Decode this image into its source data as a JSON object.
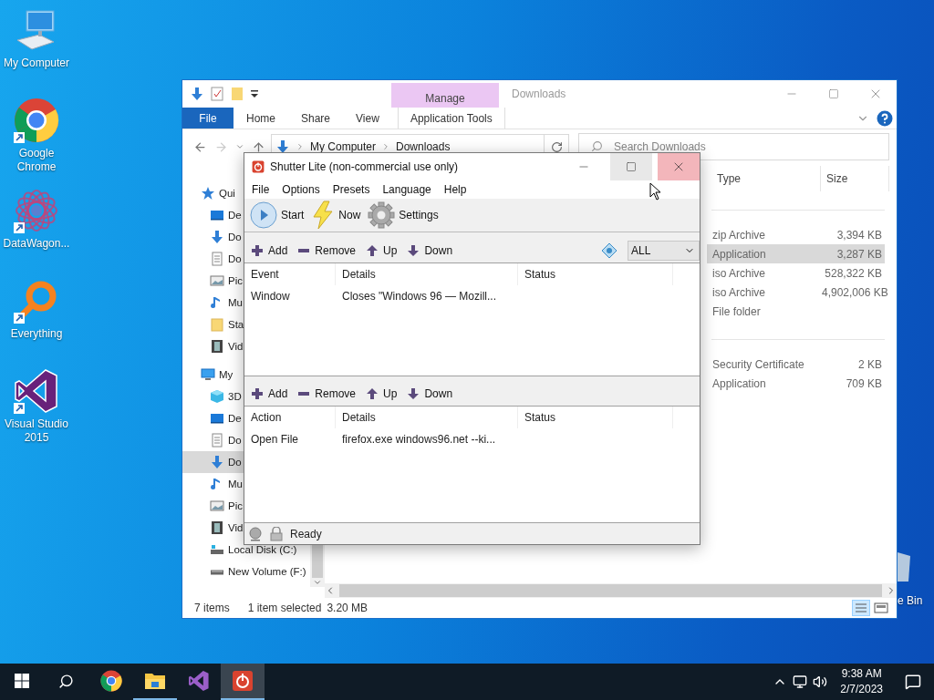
{
  "desktop_icons": [
    {
      "label": "My Computer",
      "kind": "computer",
      "shortcut": false
    },
    {
      "label": "Google Chrome",
      "kind": "chrome",
      "shortcut": true
    },
    {
      "label": "DataWagon...",
      "kind": "datawagon",
      "shortcut": true
    },
    {
      "label": "Everything",
      "kind": "everything",
      "shortcut": true
    },
    {
      "label": "Visual Studio 2015",
      "kind": "vs",
      "shortcut": true
    }
  ],
  "recycle_bin": {
    "label": "e Bin"
  },
  "explorer": {
    "title": "Downloads",
    "context_tab": "Manage",
    "ribbon_tabs": [
      {
        "label": "File",
        "kind": "file"
      },
      {
        "label": "Home",
        "kind": "tab"
      },
      {
        "label": "Share",
        "kind": "tab"
      },
      {
        "label": "View",
        "kind": "tab"
      },
      {
        "label": "Application Tools",
        "kind": "context"
      }
    ],
    "breadcrumb": [
      "My Computer",
      "Downloads"
    ],
    "search": {
      "placeholder": "Search Downloads"
    },
    "nav": [
      {
        "label": "Qui",
        "kind": "star",
        "selected": false,
        "children": [
          {
            "label": "De",
            "kind": "desktop",
            "selected": false
          },
          {
            "label": "Do",
            "kind": "download",
            "selected": false
          },
          {
            "label": "Do",
            "kind": "doc",
            "selected": false
          },
          {
            "label": "Pic",
            "kind": "picture",
            "selected": false
          },
          {
            "label": "Mu",
            "kind": "music",
            "selected": false
          },
          {
            "label": "Sta",
            "kind": "folder",
            "selected": false
          },
          {
            "label": "Vid",
            "kind": "video",
            "selected": false
          }
        ]
      },
      {
        "label": "My",
        "kind": "pc",
        "selected": false,
        "children": [
          {
            "label": "3D",
            "kind": "cube",
            "selected": false
          },
          {
            "label": "De",
            "kind": "desktop",
            "selected": false
          },
          {
            "label": "Do",
            "kind": "doc",
            "selected": false
          },
          {
            "label": "Do",
            "kind": "download",
            "selected": true
          },
          {
            "label": "Mu",
            "kind": "music",
            "selected": false
          },
          {
            "label": "Pic",
            "kind": "picture",
            "selected": false
          },
          {
            "label": "Vid",
            "kind": "video",
            "selected": false
          },
          {
            "label": "Local Disk (C:)",
            "kind": "system-drive",
            "selected": false
          },
          {
            "label": "New Volume (F:)",
            "kind": "drive",
            "selected": false
          }
        ]
      }
    ],
    "columns": [
      "Type",
      "Size"
    ],
    "groups": [
      {
        "rows": [
          {
            "type": "zip Archive",
            "size": "3,394 KB",
            "selected": false
          },
          {
            "type": "Application",
            "size": "3,287 KB",
            "selected": true
          },
          {
            "type": "iso Archive",
            "size": "528,322 KB",
            "selected": false
          },
          {
            "type": "iso Archive",
            "size": "4,902,006 KB",
            "selected": false
          },
          {
            "type": "File folder",
            "size": "",
            "selected": false
          }
        ]
      },
      {
        "rows": [
          {
            "type": "Security Certificate",
            "size": "2 KB",
            "selected": false
          },
          {
            "type": "Application",
            "size": "709 KB",
            "selected": false
          }
        ]
      }
    ],
    "status": {
      "count": "7 items",
      "selection": "1 item selected",
      "size": "3.20 MB"
    }
  },
  "shutter": {
    "title": "Shutter Lite (non-commercial use only)",
    "menu": [
      "File",
      "Options",
      "Presets",
      "Language",
      "Help"
    ],
    "tools": [
      {
        "label": "Start",
        "kind": "start"
      },
      {
        "label": "Now",
        "kind": "now"
      },
      {
        "label": "Settings",
        "kind": "settings"
      }
    ],
    "events": {
      "toolbar": [
        {
          "label": "Add",
          "kind": "add"
        },
        {
          "label": "Remove",
          "kind": "remove"
        },
        {
          "label": "Up",
          "kind": "up"
        },
        {
          "label": "Down",
          "kind": "down"
        }
      ],
      "filter": "ALL",
      "columns": [
        "Event",
        "Details",
        "Status"
      ],
      "rows": [
        [
          "Window",
          "Closes \"Windows 96 — Mozill..."
        ]
      ]
    },
    "actions": {
      "toolbar": [
        {
          "label": "Add",
          "kind": "add"
        },
        {
          "label": "Remove",
          "kind": "remove"
        },
        {
          "label": "Up",
          "kind": "up"
        },
        {
          "label": "Down",
          "kind": "down"
        }
      ],
      "columns": [
        "Action",
        "Details",
        "Status"
      ],
      "rows": [
        [
          "Open File",
          "firefox.exe windows96.net --ki..."
        ]
      ]
    },
    "status": "Ready"
  },
  "taskbar": {
    "apps": [
      {
        "kind": "chrome",
        "running": false,
        "active": false
      },
      {
        "kind": "explorer",
        "running": true,
        "active": false
      },
      {
        "kind": "vs",
        "running": false,
        "active": false
      },
      {
        "kind": "shutter",
        "running": true,
        "active": true
      }
    ],
    "time": "9:38 AM",
    "date": "2/7/2023"
  }
}
